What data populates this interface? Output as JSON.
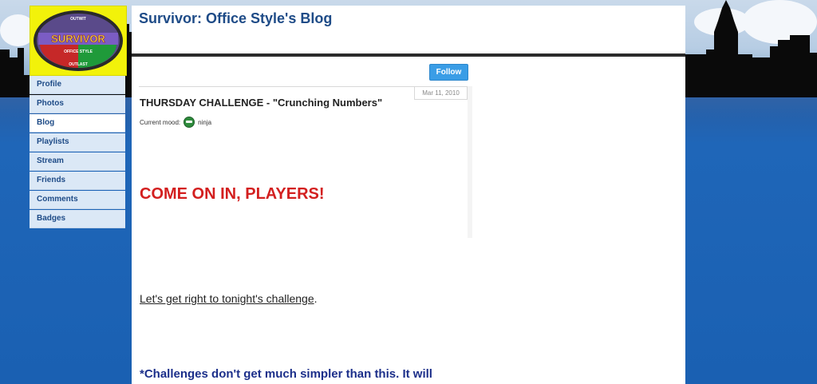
{
  "blog": {
    "title": "Survivor: Office Style's Blog"
  },
  "logo": {
    "top_text": "OUTWIT",
    "main_text": "SURVIVOR",
    "sub_text": "OFFICE STYLE",
    "bottom_text": "OUTLAST",
    "colors": {
      "background": "#f2f20a",
      "red": "#d32626",
      "green": "#1f9a3a",
      "purple": "#6b3fa0"
    }
  },
  "sidebar": {
    "items": [
      {
        "label": "Profile"
      },
      {
        "label": "Photos"
      },
      {
        "label": "Blog",
        "active": true
      },
      {
        "label": "Playlists"
      },
      {
        "label": "Stream"
      },
      {
        "label": "Friends"
      },
      {
        "label": "Comments"
      },
      {
        "label": "Badges"
      }
    ]
  },
  "follow": {
    "label": "Follow"
  },
  "post": {
    "date": "Mar 11, 2010",
    "title": "THURSDAY CHALLENGE - \"Crunching Numbers\"",
    "mood_label": "Current mood:",
    "mood_value": "ninja",
    "mood_icon": "ninja-icon",
    "headline": "COME ON IN, PLAYERS!",
    "body_link": "Let's get right to tonight's challenge",
    "body_tail": ".",
    "note": "*Challenges don't get much simpler than this.  It will"
  },
  "colors": {
    "accent": "#1e4b87",
    "follow_button": "#3a9de6",
    "headline_red": "#d31f1f",
    "note_blue": "#1c2f8a"
  }
}
